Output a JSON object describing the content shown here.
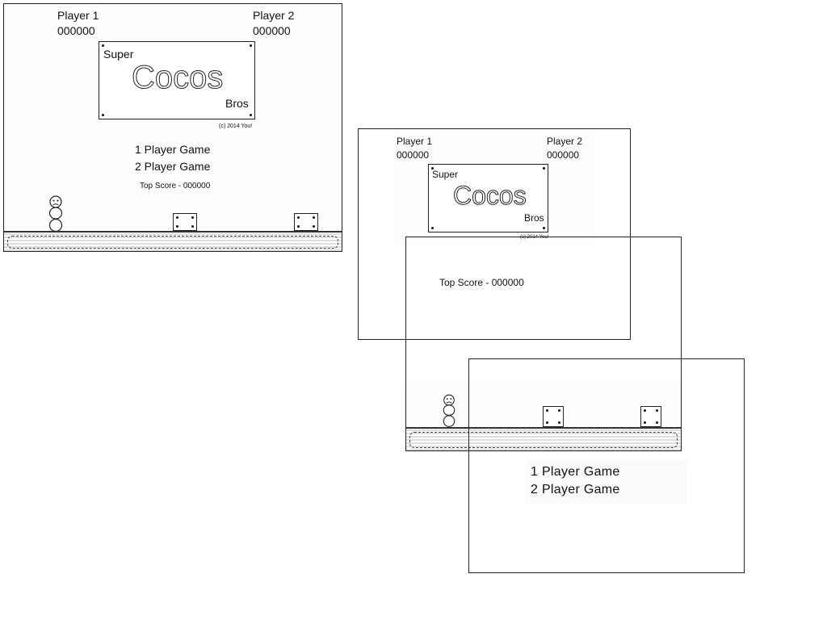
{
  "hud": {
    "player1_label": "Player 1",
    "player1_score": "000000",
    "player2_label": "Player 2",
    "player2_score": "000000"
  },
  "logo": {
    "super": "Super",
    "cocos": "Cocos",
    "bros": "Bros",
    "copyright": "(c) 2014 You!"
  },
  "menu": {
    "one_player": "1 Player Game",
    "two_player": "2 Player Game",
    "top_score": "Top Score - 000000"
  },
  "icons": {
    "character": "snowman-character-icon",
    "block": "bonus-block-icon"
  },
  "colors": {
    "background": "#ffffff",
    "line": "#222222"
  }
}
